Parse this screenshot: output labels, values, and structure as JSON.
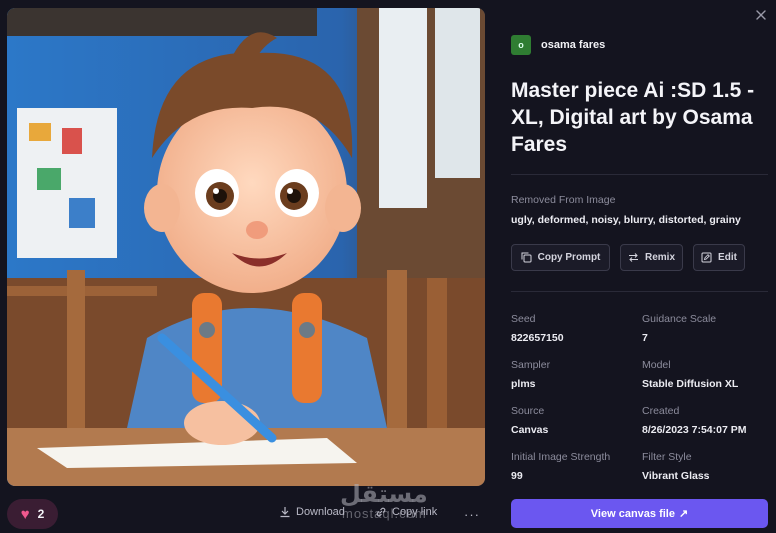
{
  "image": {
    "icon": "generated-artwork"
  },
  "bottom_bar": {
    "likes": "2",
    "download_label": "Download",
    "copy_link_label": "Copy link",
    "more": "···"
  },
  "watermark": {
    "main": "مستقل",
    "sub": "mostaql.com"
  },
  "author": {
    "initial": "o",
    "name": "osama fares"
  },
  "title": "Master piece Ai :SD 1.5 - XL, Digital art by Osama Fares",
  "negative": {
    "label": "Removed From Image",
    "text": "ugly, deformed, noisy, blurry, distorted, grainy"
  },
  "actions": {
    "copy_prompt": "Copy Prompt",
    "remix": "Remix",
    "edit": "Edit"
  },
  "details": {
    "seed_label": "Seed",
    "seed": "822657150",
    "guidance_label": "Guidance Scale",
    "guidance": "7",
    "sampler_label": "Sampler",
    "sampler": "plms",
    "model_label": "Model",
    "model": "Stable Diffusion XL",
    "source_label": "Source",
    "source": "Canvas",
    "created_label": "Created",
    "created": "8/26/2023 7:54:07 PM",
    "strength_label": "Initial Image Strength",
    "strength": "99",
    "filter_label": "Filter Style",
    "filter": "Vibrant Glass"
  },
  "cta": {
    "label": "View canvas file",
    "arrow": "↗"
  },
  "colors": {
    "accent": "#6b57f0",
    "like_bg": "#3a1d33",
    "heart": "#f0588e",
    "avatar": "#2f7d32"
  }
}
